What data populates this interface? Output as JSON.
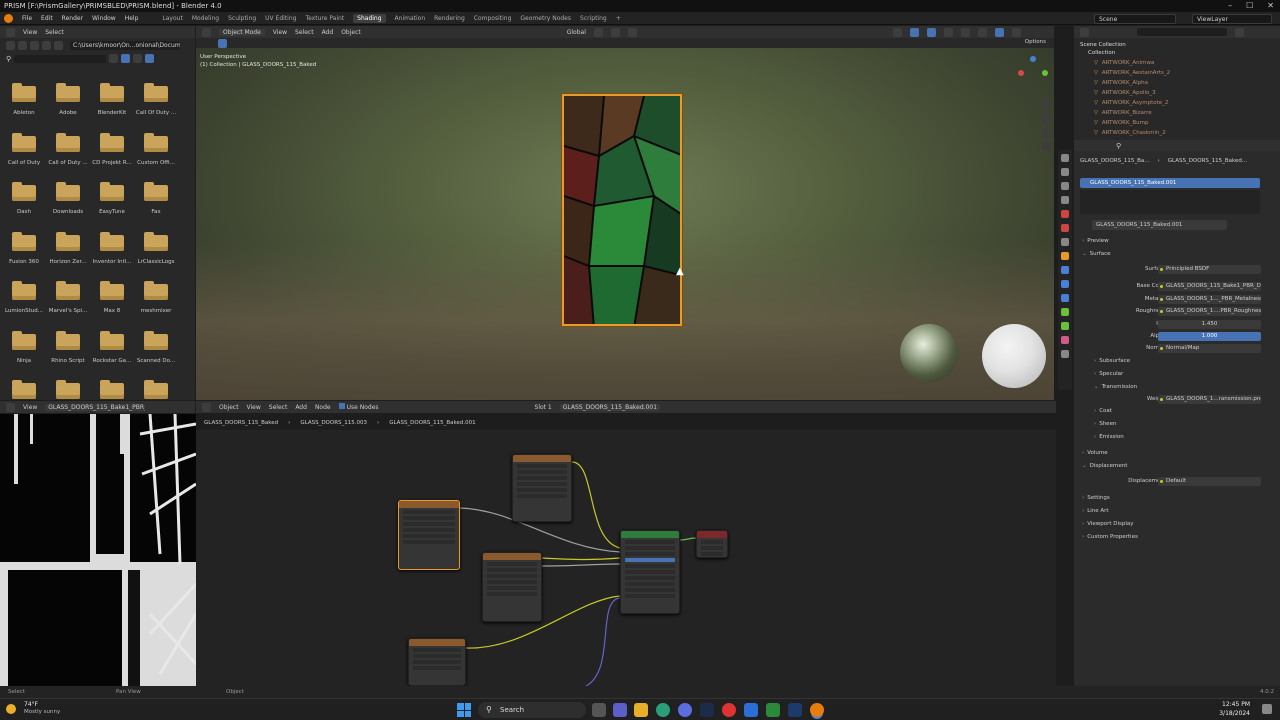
{
  "title": "PRISM [F:\\PrismGallery\\PRIMSBLED\\PRISM.blend] - Blender 4.0",
  "window_controls": [
    "–",
    "☐",
    "✕"
  ],
  "menus": [
    "File",
    "Edit",
    "Render",
    "Window",
    "Help"
  ],
  "workspaces": [
    "Layout",
    "Modeling",
    "Sculpting",
    "UV Editing",
    "Texture Paint",
    "Shading",
    "Animation",
    "Rendering",
    "Compositing",
    "Geometry Nodes",
    "Scripting"
  ],
  "active_workspace": "Shading",
  "add_tab": "+",
  "scene_name": "Scene",
  "view_layer": "ViewLayer",
  "file_browser": {
    "menus": [
      "View",
      "Select"
    ],
    "path": "C:\\Users\\kmoor\\On...onional\\Documents\\",
    "folders": [
      "Ableton",
      "Adobe",
      "BlenderKit",
      "Call Of Duty ...",
      "Call of Duty",
      "Call of Duty ...",
      "CD Projekt R...",
      "Custom Offi...",
      "Dash",
      "Downloads",
      "EasyTune",
      "Fax",
      "Fusion 360",
      "Horizon Zer...",
      "Inventor Intl...",
      "LrClassicLogs",
      "LumionStud...",
      "Marvel's Spi...",
      "Max 8",
      "meshmixer",
      "Ninja",
      "Rhino Script",
      "Rockstar Ga...",
      "Scanned Do...",
      "",
      "",
      "",
      ""
    ]
  },
  "viewport": {
    "mode": "Object Mode",
    "menus": [
      "View",
      "Select",
      "Add",
      "Object"
    ],
    "transform": "Global",
    "options": "Options",
    "overlay_line1": "User Perspective",
    "overlay_line2": "(1) Collection | GLASS_DOORS_115_Baked"
  },
  "image_editor": {
    "menu": "View",
    "image_name": "GLASS_DOORS_115_Bake1_PBR_Roug"
  },
  "node_editor": {
    "mode": "Object",
    "menus": [
      "View",
      "Select",
      "Add",
      "Node"
    ],
    "use_nodes": "Use Nodes",
    "slot": "Slot 1",
    "material": "GLASS_DOORS_115_Baked.001",
    "breadcrumb": [
      "GLASS_DOORS_115_Baked",
      "GLASS_DOORS_115.003",
      "GLASS_DOORS_115_Baked.001"
    ]
  },
  "outliner": {
    "root": "Scene Collection",
    "collection": "Collection",
    "items": [
      "ARTWORK_Animwa",
      "ARTWORK_AestainArts_2",
      "ARTWORK_Alpha",
      "ARTWORK_Apollo_3",
      "ARTWORK_Asymptote_2",
      "ARTWORK_Bizarre",
      "ARTWORK_Bump",
      "ARTWORK_Chaskmin_2"
    ]
  },
  "properties": {
    "object_name": "GLASS_DOORS_115_Ba...",
    "material_name_short": "GLASS_DOORS_115_Baked...",
    "slot_item": "GLASS_DOORS_115_Baked.001",
    "material_field": "GLASS_DOORS_115_Baked.001",
    "preview": "Preview",
    "surface": "Surface",
    "rows": [
      {
        "label": "Surface",
        "value": "Principled BSDF"
      },
      {
        "label": "Base Color",
        "value": "GLASS_DOORS_115_Bake1_PBR_D..."
      },
      {
        "label": "Metallic",
        "value": "GLASS_DOORS_1..._PBR_Metalness"
      },
      {
        "label": "Roughness",
        "value": "GLASS_DOORS_1....PBR_Roughness"
      },
      {
        "label": "IOR",
        "value": "1.450"
      },
      {
        "label": "Alpha",
        "value": "1.000"
      },
      {
        "label": "Normal",
        "value": "Normal/Map"
      }
    ],
    "subsections": [
      "Subsurface",
      "Specular",
      "Transmission"
    ],
    "weight": {
      "label": "Weight",
      "value": "GLASS_DOORS_1...ransmission.png"
    },
    "subsections2": [
      "Coat",
      "Sheen",
      "Emission"
    ],
    "volume": "Volume",
    "displacement": "Displacement",
    "displacement_row": {
      "label": "Displacement",
      "value": "Default"
    },
    "other_sections": [
      "Settings",
      "Line Art",
      "Viewport Display",
      "Custom Properties"
    ]
  },
  "status": {
    "left": "Select",
    "mid": "Pan View",
    "right": "Object",
    "version": "4.0.2"
  },
  "taskbar": {
    "weather_temp": "74°F",
    "weather_desc": "Mostly sunny",
    "search": "Search",
    "time": "12:45 PM",
    "date": "3/18/2024"
  }
}
